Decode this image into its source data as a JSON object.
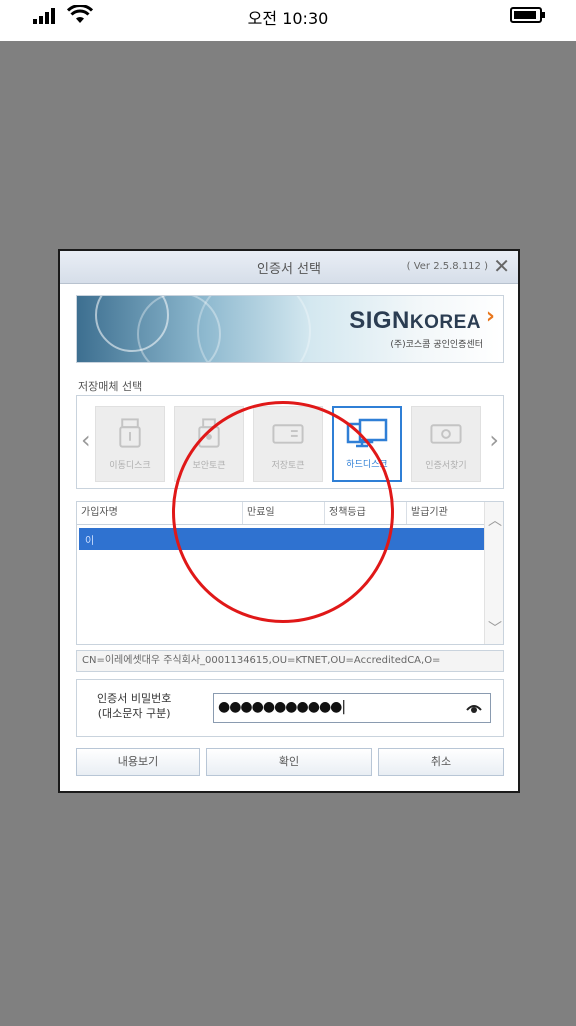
{
  "status_bar": {
    "time": "오전 10:30"
  },
  "dialog": {
    "title": "인증서 선택",
    "version": "( Ver 2.5.8.112 )",
    "close_label": "✕",
    "banner": {
      "logo_main": "SIGN",
      "logo_korea": "KOREA",
      "logo_sub": "(주)코스콤 공인인증센터"
    },
    "media_section_label": "저장매체 선택",
    "nav": {
      "prev": "‹",
      "next": "›"
    },
    "media": [
      {
        "label": "이동디스크",
        "icon": "usb-icon",
        "selected": false
      },
      {
        "label": "보안토큰",
        "icon": "token-icon",
        "selected": false
      },
      {
        "label": "저장토큰",
        "icon": "smartcard-icon",
        "selected": false
      },
      {
        "label": "하드디스크",
        "icon": "harddisk-icon",
        "selected": true
      },
      {
        "label": "인증서찾기",
        "icon": "search-cert-icon",
        "selected": false
      }
    ],
    "table": {
      "headers": [
        "가입자명",
        "만료일",
        "정책등급",
        "발급기관"
      ],
      "rows": [
        {
          "name": "이",
          "expiry": "",
          "policy": "",
          "issuer": "",
          "selected": true
        }
      ]
    },
    "dn": "CN=이레에셋대우 주식회사_0001134615,OU=KTNET,OU=AccreditedCA,O=",
    "password": {
      "label_line1": "인증서 비밀번호",
      "label_line2": "(대소문자 구분)",
      "masked_value": "●●●●●●●●●●●|"
    },
    "buttons": {
      "view": "내용보기",
      "ok": "확인",
      "cancel": "취소"
    }
  },
  "colors": {
    "accent": "#2f7fd6",
    "highlight": "#e01818",
    "backdrop": "#808080"
  }
}
